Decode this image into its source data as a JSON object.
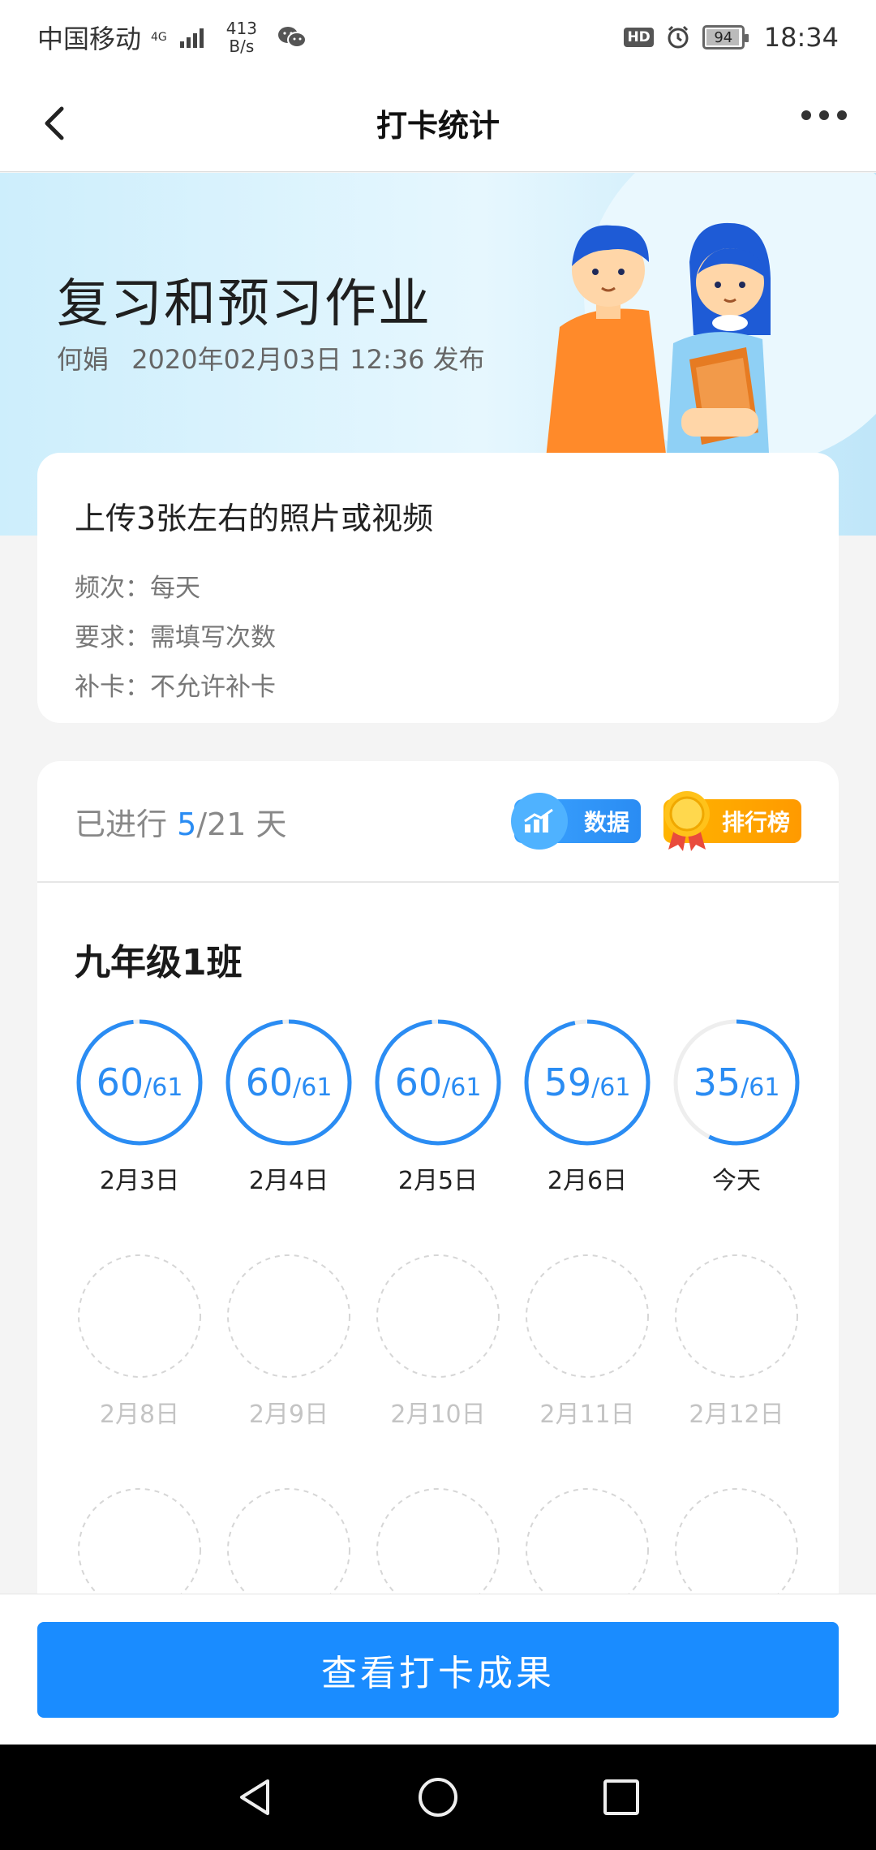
{
  "status_bar": {
    "carrier": "中国移动",
    "network": "4G",
    "net_speed_value": "413",
    "net_speed_unit": "B/s",
    "hd": "HD",
    "battery": "94",
    "time": "18:34"
  },
  "nav": {
    "title": "打卡统计"
  },
  "hero": {
    "title": "复习和预习作业",
    "author": "何娟",
    "published": "2020年02月03日 12:36 发布"
  },
  "info": {
    "task": "上传3张左右的照片或视频",
    "rows": [
      "频次：每天",
      "要求：需填写次数",
      "补卡：不允许补卡"
    ]
  },
  "stats": {
    "progress_prefix": "已进行 ",
    "days_done": "5",
    "days_total": "/21 天",
    "data_button": "数据",
    "rank_button": "排行榜",
    "class_name": "九年级1班",
    "total": 61,
    "total_label": "/61",
    "days": [
      {
        "date": "2月3日",
        "count": 60,
        "count_label": "60"
      },
      {
        "date": "2月4日",
        "count": 60,
        "count_label": "60"
      },
      {
        "date": "2月5日",
        "count": 60,
        "count_label": "60"
      },
      {
        "date": "2月6日",
        "count": 59,
        "count_label": "59"
      },
      {
        "date": "今天",
        "count": 35,
        "count_label": "35"
      }
    ],
    "future_days": [
      "2月8日",
      "2月9日",
      "2月10日",
      "2月11日",
      "2月12日"
    ]
  },
  "cta": {
    "label": "查看打卡成果"
  },
  "colors": {
    "accent": "#2a8cf3",
    "cta": "#1a8cff",
    "rank": "#ff9a00"
  },
  "icons": [
    "back-icon",
    "more-icon",
    "chart-icon",
    "medal-icon",
    "back-triangle-icon",
    "home-circle-icon",
    "recent-square-icon"
  ]
}
